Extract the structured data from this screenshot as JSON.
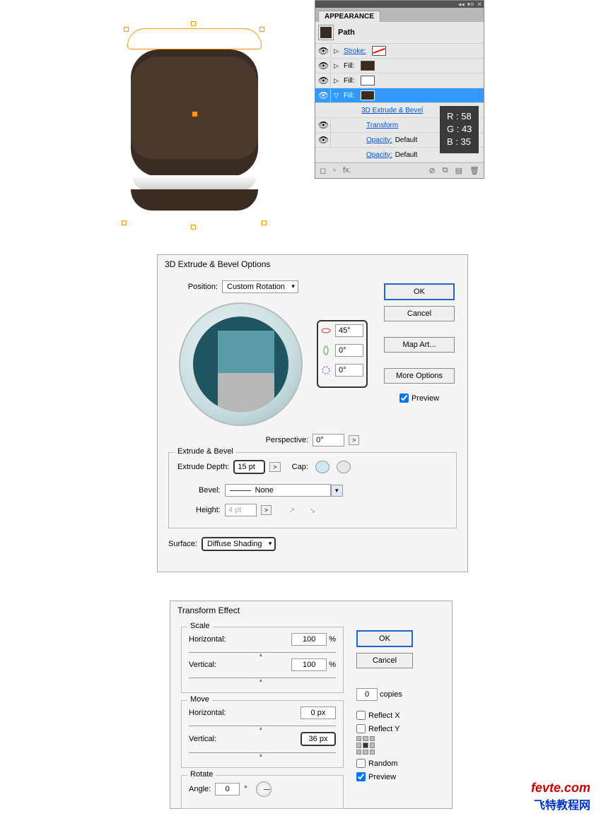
{
  "appearance": {
    "tab": "APPEARANCE",
    "path_label": "Path",
    "rows": {
      "stroke": "Stroke:",
      "fill": "Fill:",
      "extrude": "3D Extrude & Bevel",
      "transform": "Transform",
      "opacity": "Opacity:",
      "opacity_val": "Default"
    },
    "fx_label": "fx."
  },
  "rgb": {
    "r": "R : 58",
    "g": "G : 43",
    "b": "B : 35"
  },
  "extrude": {
    "title": "3D Extrude & Bevel Options",
    "position_label": "Position:",
    "position_val": "Custom Rotation",
    "rot_x": "45°",
    "rot_y": "0°",
    "rot_z": "0°",
    "perspective_label": "Perspective:",
    "perspective_val": "0°",
    "section": "Extrude & Bevel",
    "depth_label": "Extrude Depth:",
    "depth_val": "15 pt",
    "cap_label": "Cap:",
    "bevel_label": "Bevel:",
    "bevel_val": "None",
    "height_label": "Height:",
    "height_val": "4 pt",
    "surface_label": "Surface:",
    "surface_val": "Diffuse Shading",
    "ok": "OK",
    "cancel": "Cancel",
    "map_art": "Map Art...",
    "more_options": "More Options",
    "preview": "Preview"
  },
  "transform": {
    "title": "Transform Effect",
    "scale": "Scale",
    "move": "Move",
    "rotate": "Rotate",
    "horizontal": "Horizontal:",
    "vertical": "Vertical:",
    "angle": "Angle:",
    "scale_h": "100",
    "scale_v": "100",
    "scale_unit": "%",
    "move_h": "0 px",
    "move_v": "36 px",
    "angle_val": "0",
    "angle_unit": "°",
    "ok": "OK",
    "cancel": "Cancel",
    "copies_val": "0",
    "copies": "copies",
    "reflect_x": "Reflect X",
    "reflect_y": "Reflect Y",
    "random": "Random",
    "preview": "Preview"
  },
  "watermark": {
    "en": "fevte.com",
    "cn": "飞特教程网"
  }
}
